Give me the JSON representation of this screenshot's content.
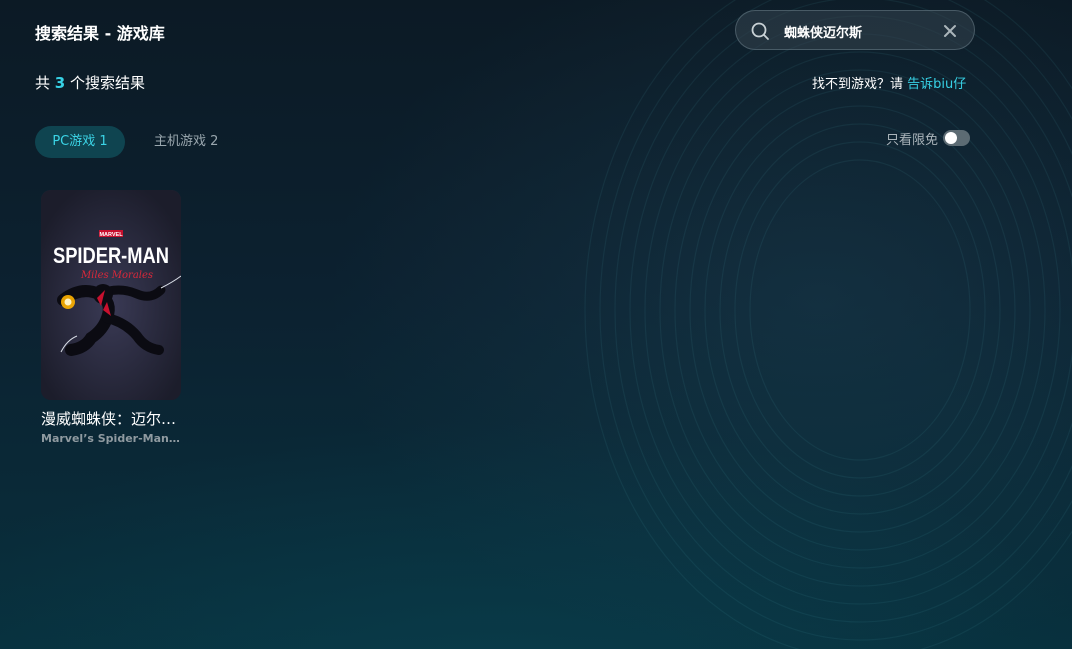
{
  "header": {
    "title": "搜索结果 - 游戏库"
  },
  "search": {
    "value": "蜘蛛侠迈尔斯",
    "icon": "search-icon",
    "clear_icon": "clear-icon"
  },
  "summary": {
    "prefix": "共 ",
    "count": "3",
    "suffix": " 个搜索结果"
  },
  "feedback": {
    "text": "找不到游戏？请 ",
    "link": "告诉biu仔"
  },
  "tabs": [
    {
      "label": "PC游戏 1",
      "active": true
    },
    {
      "label": "主机游戏 2",
      "active": false
    }
  ],
  "filter": {
    "label": "只看限免",
    "enabled": false
  },
  "games": [
    {
      "title": "漫威蜘蛛侠：迈尔斯·莫拉莱斯",
      "subtitle": "Marvel’s Spider-Man: Miles Morales",
      "cover": {
        "brand": "MARVEL",
        "logo": "SPIDER-MAN",
        "logo_sub": "Miles Morales"
      }
    }
  ],
  "colors": {
    "accent": "#37d2e6",
    "tab_active_bg": "#0f4450",
    "background": "#0c2130"
  }
}
